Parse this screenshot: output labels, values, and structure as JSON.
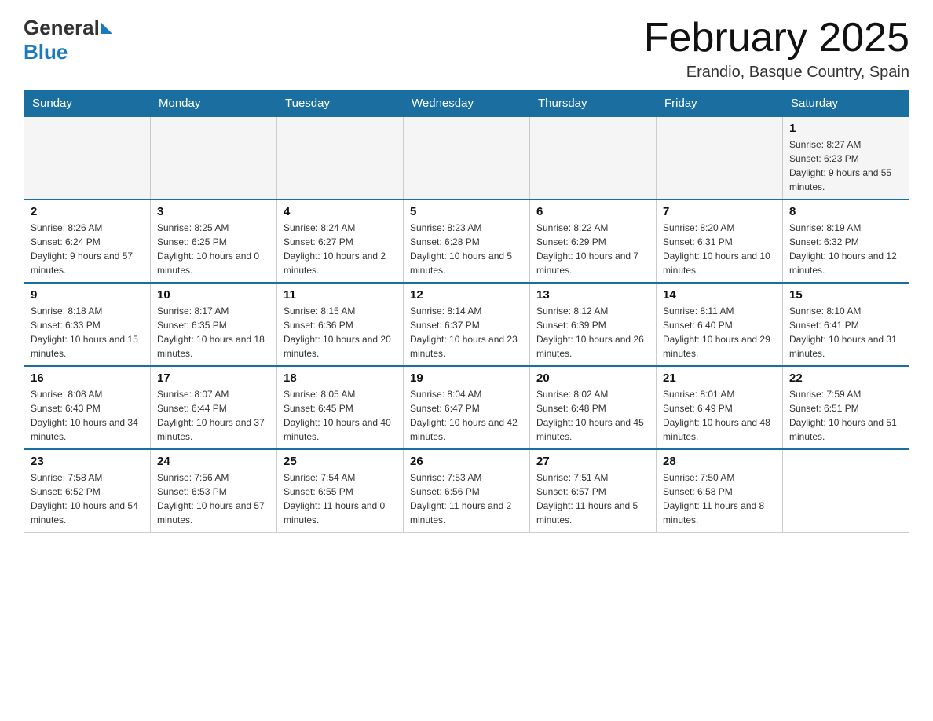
{
  "header": {
    "logo": {
      "general": "General",
      "blue": "Blue"
    },
    "title": "February 2025",
    "location": "Erandio, Basque Country, Spain"
  },
  "days_of_week": [
    "Sunday",
    "Monday",
    "Tuesday",
    "Wednesday",
    "Thursday",
    "Friday",
    "Saturday"
  ],
  "weeks": [
    [
      {
        "day": "",
        "info": ""
      },
      {
        "day": "",
        "info": ""
      },
      {
        "day": "",
        "info": ""
      },
      {
        "day": "",
        "info": ""
      },
      {
        "day": "",
        "info": ""
      },
      {
        "day": "",
        "info": ""
      },
      {
        "day": "1",
        "info": "Sunrise: 8:27 AM\nSunset: 6:23 PM\nDaylight: 9 hours and 55 minutes."
      }
    ],
    [
      {
        "day": "2",
        "info": "Sunrise: 8:26 AM\nSunset: 6:24 PM\nDaylight: 9 hours and 57 minutes."
      },
      {
        "day": "3",
        "info": "Sunrise: 8:25 AM\nSunset: 6:25 PM\nDaylight: 10 hours and 0 minutes."
      },
      {
        "day": "4",
        "info": "Sunrise: 8:24 AM\nSunset: 6:27 PM\nDaylight: 10 hours and 2 minutes."
      },
      {
        "day": "5",
        "info": "Sunrise: 8:23 AM\nSunset: 6:28 PM\nDaylight: 10 hours and 5 minutes."
      },
      {
        "day": "6",
        "info": "Sunrise: 8:22 AM\nSunset: 6:29 PM\nDaylight: 10 hours and 7 minutes."
      },
      {
        "day": "7",
        "info": "Sunrise: 8:20 AM\nSunset: 6:31 PM\nDaylight: 10 hours and 10 minutes."
      },
      {
        "day": "8",
        "info": "Sunrise: 8:19 AM\nSunset: 6:32 PM\nDaylight: 10 hours and 12 minutes."
      }
    ],
    [
      {
        "day": "9",
        "info": "Sunrise: 8:18 AM\nSunset: 6:33 PM\nDaylight: 10 hours and 15 minutes."
      },
      {
        "day": "10",
        "info": "Sunrise: 8:17 AM\nSunset: 6:35 PM\nDaylight: 10 hours and 18 minutes."
      },
      {
        "day": "11",
        "info": "Sunrise: 8:15 AM\nSunset: 6:36 PM\nDaylight: 10 hours and 20 minutes."
      },
      {
        "day": "12",
        "info": "Sunrise: 8:14 AM\nSunset: 6:37 PM\nDaylight: 10 hours and 23 minutes."
      },
      {
        "day": "13",
        "info": "Sunrise: 8:12 AM\nSunset: 6:39 PM\nDaylight: 10 hours and 26 minutes."
      },
      {
        "day": "14",
        "info": "Sunrise: 8:11 AM\nSunset: 6:40 PM\nDaylight: 10 hours and 29 minutes."
      },
      {
        "day": "15",
        "info": "Sunrise: 8:10 AM\nSunset: 6:41 PM\nDaylight: 10 hours and 31 minutes."
      }
    ],
    [
      {
        "day": "16",
        "info": "Sunrise: 8:08 AM\nSunset: 6:43 PM\nDaylight: 10 hours and 34 minutes."
      },
      {
        "day": "17",
        "info": "Sunrise: 8:07 AM\nSunset: 6:44 PM\nDaylight: 10 hours and 37 minutes."
      },
      {
        "day": "18",
        "info": "Sunrise: 8:05 AM\nSunset: 6:45 PM\nDaylight: 10 hours and 40 minutes."
      },
      {
        "day": "19",
        "info": "Sunrise: 8:04 AM\nSunset: 6:47 PM\nDaylight: 10 hours and 42 minutes."
      },
      {
        "day": "20",
        "info": "Sunrise: 8:02 AM\nSunset: 6:48 PM\nDaylight: 10 hours and 45 minutes."
      },
      {
        "day": "21",
        "info": "Sunrise: 8:01 AM\nSunset: 6:49 PM\nDaylight: 10 hours and 48 minutes."
      },
      {
        "day": "22",
        "info": "Sunrise: 7:59 AM\nSunset: 6:51 PM\nDaylight: 10 hours and 51 minutes."
      }
    ],
    [
      {
        "day": "23",
        "info": "Sunrise: 7:58 AM\nSunset: 6:52 PM\nDaylight: 10 hours and 54 minutes."
      },
      {
        "day": "24",
        "info": "Sunrise: 7:56 AM\nSunset: 6:53 PM\nDaylight: 10 hours and 57 minutes."
      },
      {
        "day": "25",
        "info": "Sunrise: 7:54 AM\nSunset: 6:55 PM\nDaylight: 11 hours and 0 minutes."
      },
      {
        "day": "26",
        "info": "Sunrise: 7:53 AM\nSunset: 6:56 PM\nDaylight: 11 hours and 2 minutes."
      },
      {
        "day": "27",
        "info": "Sunrise: 7:51 AM\nSunset: 6:57 PM\nDaylight: 11 hours and 5 minutes."
      },
      {
        "day": "28",
        "info": "Sunrise: 7:50 AM\nSunset: 6:58 PM\nDaylight: 11 hours and 8 minutes."
      },
      {
        "day": "",
        "info": ""
      }
    ]
  ]
}
